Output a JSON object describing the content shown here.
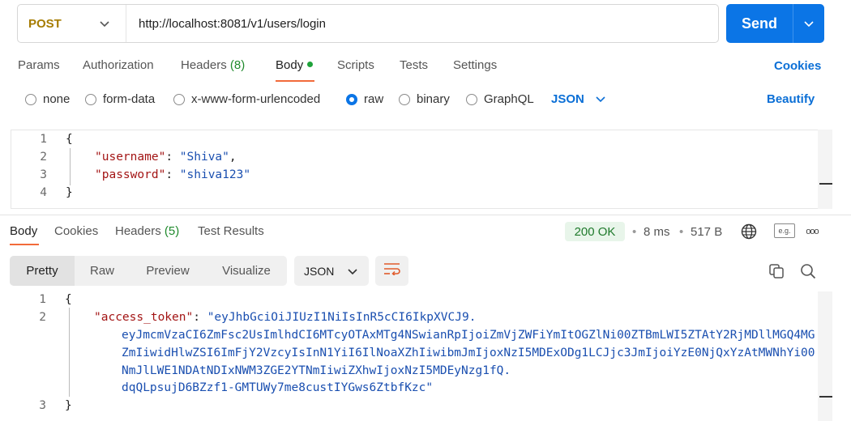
{
  "request": {
    "method": "POST",
    "url": "http://localhost:8081/v1/users/login",
    "send_label": "Send"
  },
  "request_tabs": {
    "params": "Params",
    "authorization": "Authorization",
    "headers": "Headers",
    "headers_count": "(8)",
    "body": "Body",
    "scripts": "Scripts",
    "tests": "Tests",
    "settings": "Settings",
    "cookies": "Cookies"
  },
  "body_types": {
    "none": "none",
    "form_data": "form-data",
    "urlencoded": "x-www-form-urlencoded",
    "raw": "raw",
    "binary": "binary",
    "graphql": "GraphQL",
    "selected_format": "JSON",
    "beautify": "Beautify"
  },
  "request_body": {
    "line_numbers": [
      "1",
      "2",
      "3",
      "4"
    ],
    "open_brace": "{",
    "close_brace": "}",
    "fields": [
      {
        "key": "\"username\"",
        "colon": ": ",
        "value": "\"Shiva\"",
        "trail": ","
      },
      {
        "key": "\"password\"",
        "colon": ": ",
        "value": "\"shiva123\"",
        "trail": ""
      }
    ]
  },
  "response_tabs": {
    "body": "Body",
    "cookies": "Cookies",
    "headers": "Headers",
    "headers_count": "(5)",
    "test_results": "Test Results"
  },
  "response_meta": {
    "status": "200 OK",
    "time": "8 ms",
    "size": "517 B",
    "sep": "•",
    "eg_badge": "e.g.",
    "more": "ooo"
  },
  "response_view": {
    "pretty": "Pretty",
    "raw": "Raw",
    "preview": "Preview",
    "visualize": "Visualize",
    "format": "JSON"
  },
  "response_body": {
    "line_numbers": [
      "1",
      "2",
      "3"
    ],
    "open_brace": "{",
    "close_brace": "}",
    "key": "\"access_token\"",
    "colon": ": ",
    "token_lines": [
      "\"eyJhbGciOiJIUzI1NiIsInR5cCI6IkpXVCJ9.",
      "eyJmcmVzaCI6ZmFsc2UsImlhdCI6MTcyOTAxMTg4NSwianRpIjoiZmVjZWFiYmItOGZlNi00ZTBmLWI5ZTAtY2RjMDllMGQ4MG",
      "ZmIiwidHlwZSI6ImFjY2VzcyIsInN1YiI6IlNoaXZhIiwibmJmIjoxNzI5MDExODg1LCJjc3JmIjoiYzE0NjQxYzAtMWNhYi00",
      "NmJlLWE1NDAtNDIxNWM3ZGE2YTNmIiwiZXhwIjoxNzI5MDEyNzg1fQ.",
      "dqQLpsujD6BZzf1-GMTUWy7me8custIYGws6ZtbfKzc\""
    ]
  },
  "colors": {
    "accent": "#0b75e6",
    "method": "#a67c00",
    "active_tab": "#f26b3a",
    "json_key": "#a31515",
    "json_string": "#1a4fb0",
    "status_ok": "#1f7a2c"
  },
  "icons": [
    "chevron-down-icon",
    "globe-icon",
    "example-icon",
    "more-icon",
    "wrap-lines-icon",
    "copy-icon",
    "search-icon"
  ]
}
